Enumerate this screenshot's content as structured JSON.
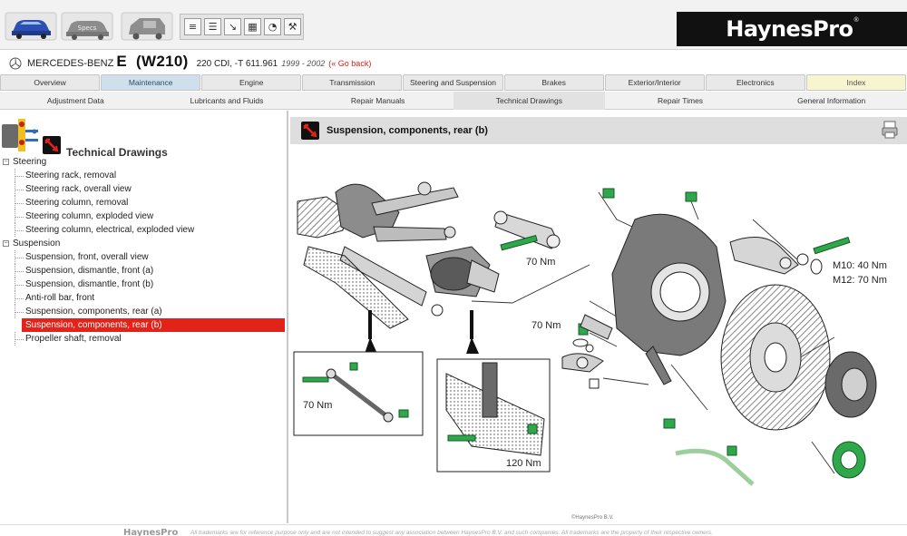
{
  "toolbar": {
    "nav_buttons": [
      "car-front-icon",
      "car-specs-icon",
      "car-side-icon"
    ],
    "nav_label": "Specs",
    "tools": [
      {
        "icon": "ruler-icon",
        "glyph": "≡"
      },
      {
        "icon": "document-icon",
        "glyph": "☰"
      },
      {
        "icon": "arrow-icon",
        "glyph": "↘"
      },
      {
        "icon": "calculator-icon",
        "glyph": "▦"
      },
      {
        "icon": "gauge-icon",
        "glyph": "◔"
      },
      {
        "icon": "wrench-icon",
        "glyph": "⚒"
      }
    ]
  },
  "brand": {
    "name": "HaynesPro",
    "reg": "®"
  },
  "vehicle": {
    "make": "MERCEDES-BENZ",
    "model": "E  (W210)",
    "variant": "220 CDI, -T 611.961",
    "years": "1999 - 2002",
    "back_link": "(« Go back)"
  },
  "tabs_primary": [
    {
      "label": "Overview",
      "state": "normal"
    },
    {
      "label": "Maintenance",
      "state": "active"
    },
    {
      "label": "Engine",
      "state": "normal"
    },
    {
      "label": "Transmission",
      "state": "normal"
    },
    {
      "label": "Steering and Suspension",
      "state": "normal"
    },
    {
      "label": "Brakes",
      "state": "normal"
    },
    {
      "label": "Exterior/Interior",
      "state": "normal"
    },
    {
      "label": "Electronics",
      "state": "normal"
    },
    {
      "label": "Index",
      "state": "index"
    }
  ],
  "tabs_secondary": [
    {
      "label": "Adjustment Data",
      "state": "normal"
    },
    {
      "label": "Lubricants and Fluids",
      "state": "normal"
    },
    {
      "label": "Repair Manuals",
      "state": "normal"
    },
    {
      "label": "Technical Drawings",
      "state": "active"
    },
    {
      "label": "Repair Times",
      "state": "normal"
    },
    {
      "label": "General Information",
      "state": "normal"
    }
  ],
  "left_panel": {
    "title": "Technical Drawings",
    "groups": [
      {
        "label": "Steering",
        "items": [
          "Steering rack, removal",
          "Steering rack, overall view",
          "Steering column, removal",
          "Steering column, exploded view",
          "Steering column, electrical, exploded view"
        ]
      },
      {
        "label": "Suspension",
        "items": [
          "Suspension, front, overall view",
          "Suspension, dismantle, front (a)",
          "Suspension, dismantle, front (b)",
          "Anti-roll bar, front",
          "Suspension, components, rear (a)",
          "Suspension, components, rear (b)",
          "Propeller shaft, removal"
        ]
      }
    ],
    "selected": "Suspension, components, rear (b)"
  },
  "drawing": {
    "title": "Suspension, components, rear (b)",
    "torque_labels": [
      "70 Nm",
      "70 Nm",
      "M10: 40 Nm",
      "M12: 70 Nm",
      "70 Nm",
      "120 Nm"
    ],
    "copyright": "©HaynesPro B.V."
  },
  "footer": {
    "logo": "HaynesPro",
    "text": "All trademarks are for reference purpose only and are not intended to suggest any association between HaynesPro B.V. and such companies. All trademarks are the property of their respective owners."
  },
  "colors": {
    "accent_red": "#e2231a",
    "bolt_green": "#2ea84a",
    "brand_black": "#111111",
    "active_tab": "#cfe0ec"
  }
}
